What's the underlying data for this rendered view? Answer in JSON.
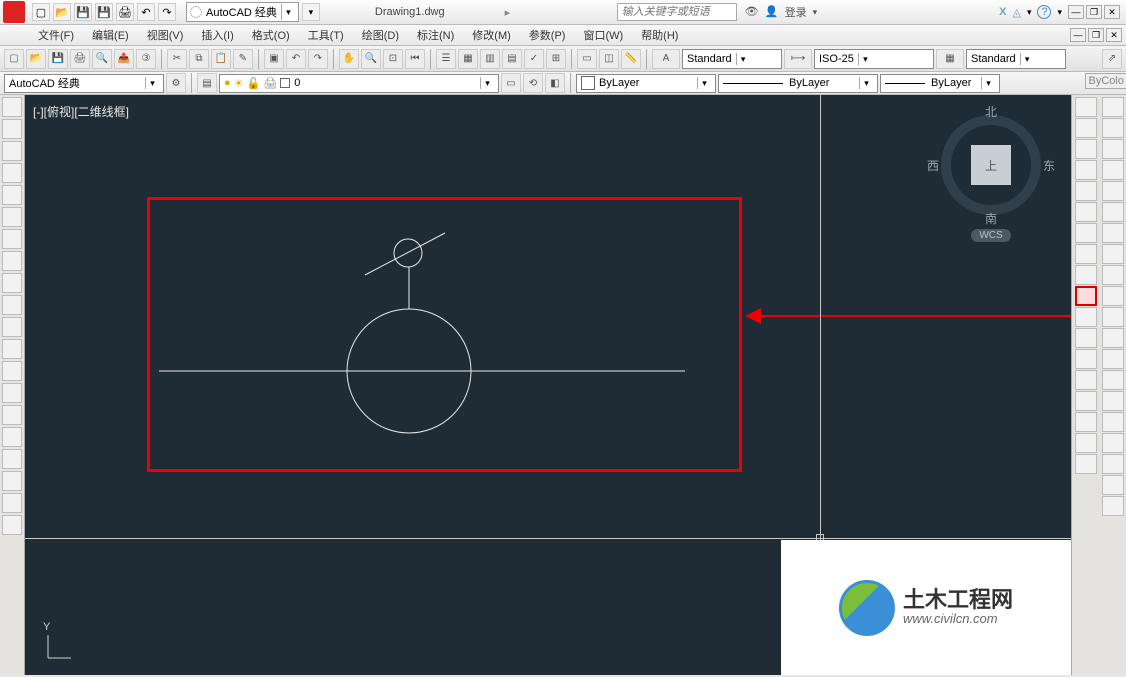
{
  "title_bar": {
    "workspace_selector": "AutoCAD 经典",
    "filename": "Drawing1.dwg",
    "search_placeholder": "输入关键字或短语",
    "login_label": "登录"
  },
  "menus": [
    "文件(F)",
    "编辑(E)",
    "视图(V)",
    "插入(I)",
    "格式(O)",
    "工具(T)",
    "绘图(D)",
    "标注(N)",
    "修改(M)",
    "参数(P)",
    "窗口(W)",
    "帮助(H)"
  ],
  "toolbar2": {
    "text_style": "Standard",
    "dim_style": "ISO-25",
    "table_style": "Standard"
  },
  "ws_row": {
    "workspace": "AutoCAD 经典",
    "layer": "0",
    "layer_state_icon": "unlocked",
    "color_label": "ByLayer",
    "linetype_label": "ByLayer",
    "lineweight_label": "ByLayer",
    "plotstyle_label": "ByColo"
  },
  "viewport": {
    "label": "[-][俯视][二维线框]"
  },
  "viewcube": {
    "top": "上",
    "north": "北",
    "south": "南",
    "east": "东",
    "west": "西",
    "wcs": "WCS"
  },
  "ucs": {
    "y_label": "Y"
  },
  "watermark": {
    "title": "土木工程网",
    "url": "www.civilcn.com"
  }
}
